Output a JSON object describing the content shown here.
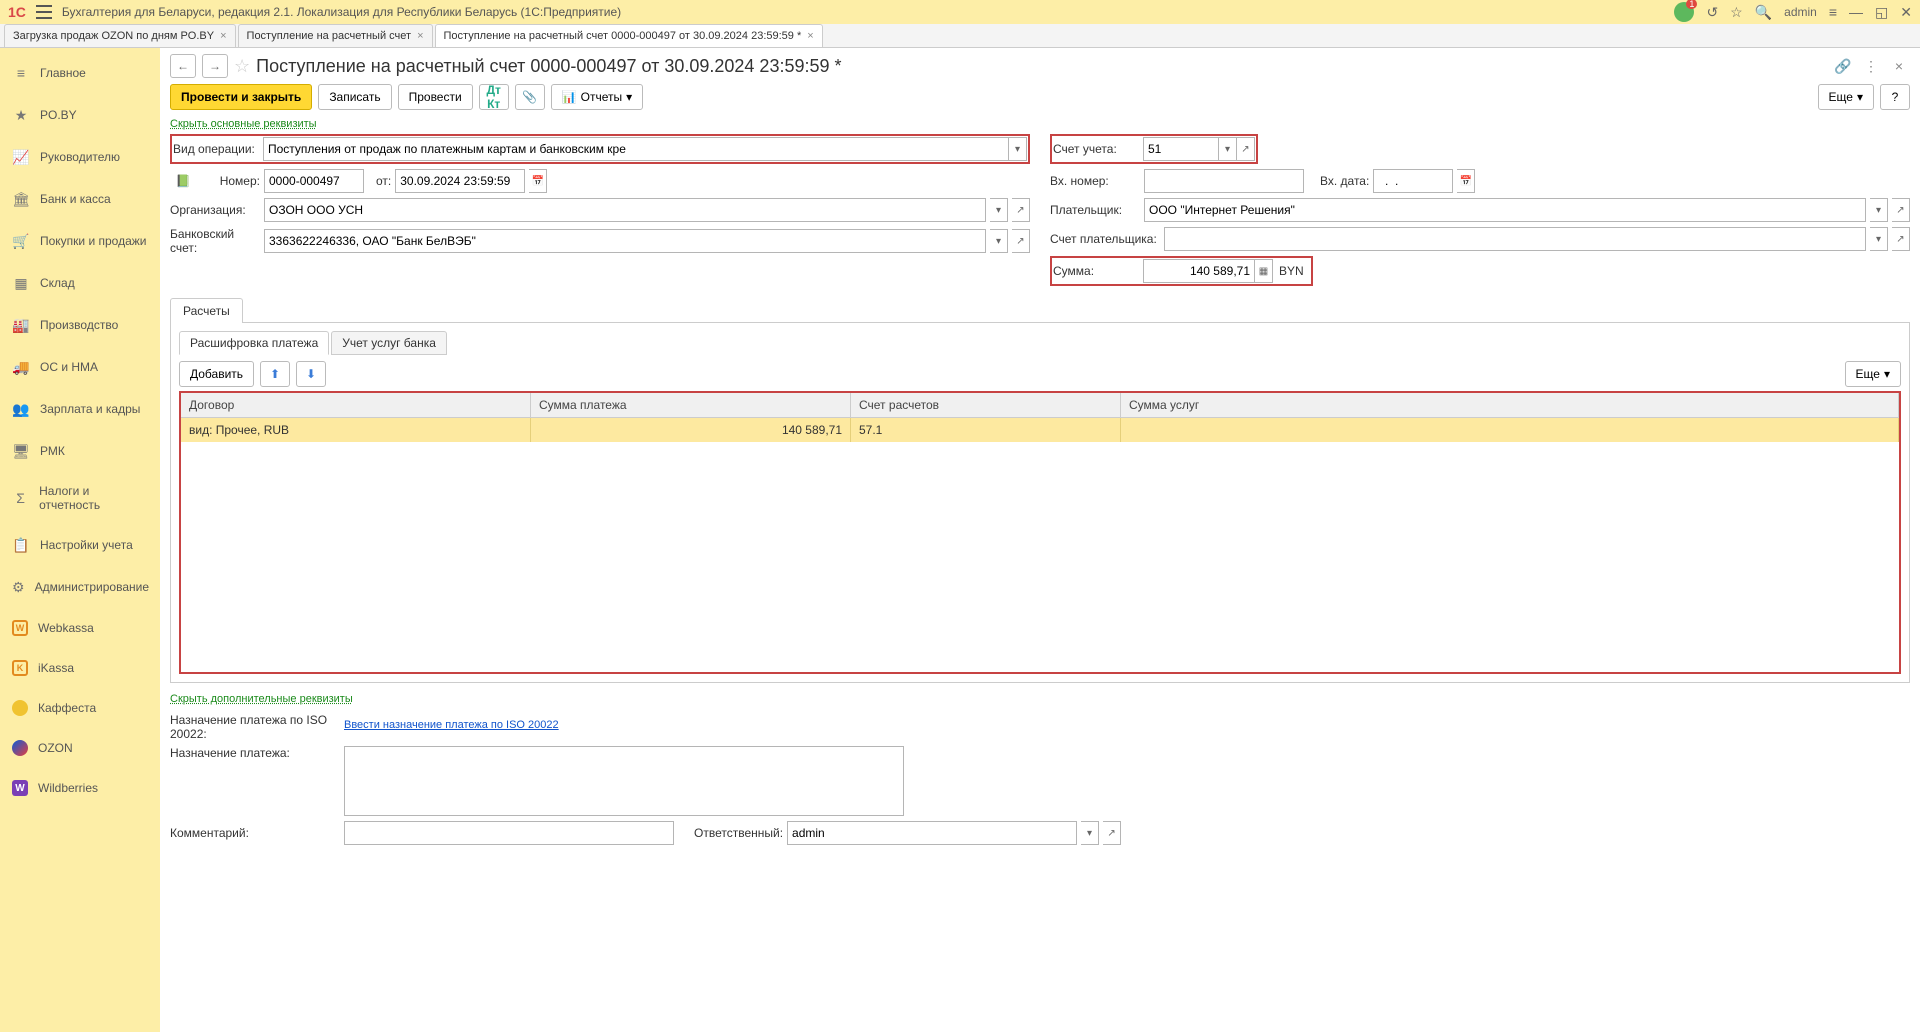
{
  "titlebar": {
    "title": "Бухгалтерия для Беларуси, редакция 2.1. Локализация для Республики Беларусь   (1С:Предприятие)",
    "user": "admin",
    "notif_count": "1"
  },
  "doctabs": [
    "Загрузка продаж OZON по дням PO.BY",
    "Поступление на расчетный счет",
    "Поступление на расчетный счет 0000-000497 от 30.09.2024 23:59:59 *"
  ],
  "sidebar": {
    "items": [
      {
        "label": "Главное",
        "icon": "home"
      },
      {
        "label": "PO.BY",
        "icon": "star"
      },
      {
        "label": "Руководителю",
        "icon": "chart"
      },
      {
        "label": "Банк и касса",
        "icon": "bank"
      },
      {
        "label": "Покупки и продажи",
        "icon": "cart"
      },
      {
        "label": "Склад",
        "icon": "boxes"
      },
      {
        "label": "Производство",
        "icon": "factory"
      },
      {
        "label": "ОС и НМА",
        "icon": "truck"
      },
      {
        "label": "Зарплата и кадры",
        "icon": "people"
      },
      {
        "label": "РМК",
        "icon": "rmk"
      },
      {
        "label": "Налоги и отчетность",
        "icon": "tax"
      },
      {
        "label": "Настройки учета",
        "icon": "clipboard"
      },
      {
        "label": "Администрирование",
        "icon": "gear"
      },
      {
        "label": "Webkassa",
        "icon": "W"
      },
      {
        "label": "iKassa",
        "icon": "K"
      },
      {
        "label": "Каффеста",
        "icon": "circle"
      },
      {
        "label": "OZON",
        "icon": "ozon"
      },
      {
        "label": "Wildberries",
        "icon": "wb"
      }
    ]
  },
  "page": {
    "title": "Поступление на расчетный счет 0000-000497 от 30.09.2024 23:59:59 *"
  },
  "toolbar": {
    "post_close": "Провести и закрыть",
    "write": "Записать",
    "post": "Провести",
    "reports": "Отчеты",
    "more": "Еще"
  },
  "links": {
    "hide_main": "Скрыть основные реквизиты",
    "hide_extra": "Скрыть дополнительные реквизиты",
    "iso_link": "Ввести назначение платежа по ISO 20022"
  },
  "form": {
    "op_type_label": "Вид операции:",
    "op_type": "Поступления от продаж по платежным картам и банковским кре",
    "acct_label": "Счет учета:",
    "acct": "51",
    "num_label": "Номер:",
    "num": "0000-000497",
    "from_label": "от:",
    "date": "30.09.2024 23:59:59",
    "ext_num_label": "Вх. номер:",
    "ext_date_label": "Вх. дата:",
    "ext_date": "  .  .    ",
    "org_label": "Организация:",
    "org": "ОЗОН ООО УСН",
    "payer_label": "Плательщик:",
    "payer": "ООО \"Интернет Решения\"",
    "bank_label": "Банковский счет:",
    "bank": "3363622246336, ОАО \"Банк БелВЭБ\"",
    "payer_acct_label": "Счет плательщика:",
    "sum_label": "Сумма:",
    "sum": "140 589,71",
    "currency": "BYN"
  },
  "tabs": {
    "main_tab": "Расчеты",
    "sub1": "Расшифровка платежа",
    "sub2": "Учет услуг банка",
    "add": "Добавить"
  },
  "table": {
    "headers": [
      "Договор",
      "Сумма платежа",
      "Счет расчетов",
      "Сумма услуг"
    ],
    "row": {
      "contract": "вид: Прочее, RUB",
      "amount": "140 589,71",
      "acct": "57.1",
      "serv": ""
    }
  },
  "bottom": {
    "iso_label": "Назначение платежа по ISO 20022:",
    "purpose_label": "Назначение платежа:",
    "comment_label": "Комментарий:",
    "resp_label": "Ответственный:",
    "resp": "admin"
  }
}
